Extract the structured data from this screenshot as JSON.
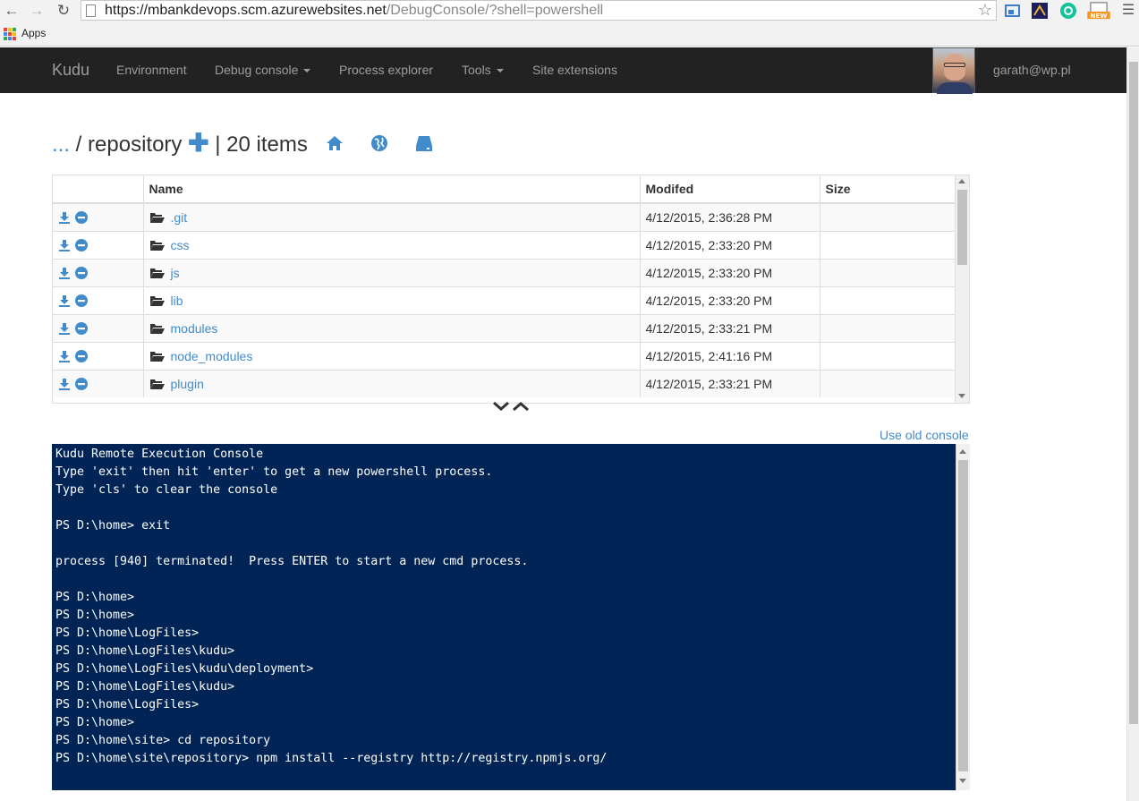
{
  "browser": {
    "url_host": "https://mbankdevops.scm.azurewebsites.net",
    "url_path": "/DebugConsole/?shell=powershell",
    "bookmarks_apps_label": "Apps"
  },
  "navbar": {
    "brand": "Kudu",
    "items": [
      {
        "label": "Environment"
      },
      {
        "label": "Debug console"
      },
      {
        "label": "Process explorer"
      },
      {
        "label": "Tools"
      },
      {
        "label": "Site extensions"
      }
    ],
    "user": "garath@wp.pl"
  },
  "breadcrumb": {
    "dots": "...",
    "separator": " / ",
    "folder": "repository",
    "count_text": "| 20 items"
  },
  "table": {
    "headers": [
      "Name",
      "Modifed",
      "Size"
    ],
    "rows": [
      {
        "name": ".git",
        "modified": "4/12/2015, 2:36:28 PM",
        "size": ""
      },
      {
        "name": "css",
        "modified": "4/12/2015, 2:33:20 PM",
        "size": ""
      },
      {
        "name": "js",
        "modified": "4/12/2015, 2:33:20 PM",
        "size": ""
      },
      {
        "name": "lib",
        "modified": "4/12/2015, 2:33:20 PM",
        "size": ""
      },
      {
        "name": "modules",
        "modified": "4/12/2015, 2:33:21 PM",
        "size": ""
      },
      {
        "name": "node_modules",
        "modified": "4/12/2015, 2:41:16 PM",
        "size": ""
      },
      {
        "name": "plugin",
        "modified": "4/12/2015, 2:33:21 PM",
        "size": ""
      }
    ]
  },
  "console": {
    "old_console_link": "Use old console",
    "lines": [
      "Kudu Remote Execution Console",
      "Type 'exit' then hit 'enter' to get a new powershell process.",
      "Type 'cls' to clear the console",
      "",
      "PS D:\\home> exit",
      "",
      "process [940] terminated!  Press ENTER to start a new cmd process.",
      "",
      "PS D:\\home>",
      "PS D:\\home>",
      "PS D:\\home\\LogFiles>",
      "PS D:\\home\\LogFiles\\kudu>",
      "PS D:\\home\\LogFiles\\kudu\\deployment>",
      "PS D:\\home\\LogFiles\\kudu>",
      "PS D:\\home\\LogFiles>",
      "PS D:\\home>",
      "PS D:\\home\\site> cd repository",
      "PS D:\\home\\site\\repository> npm install --registry http://registry.npmjs.org/"
    ]
  },
  "colors": {
    "navbar_bg": "#222222",
    "link": "#428bca",
    "console_bg": "#012456"
  }
}
